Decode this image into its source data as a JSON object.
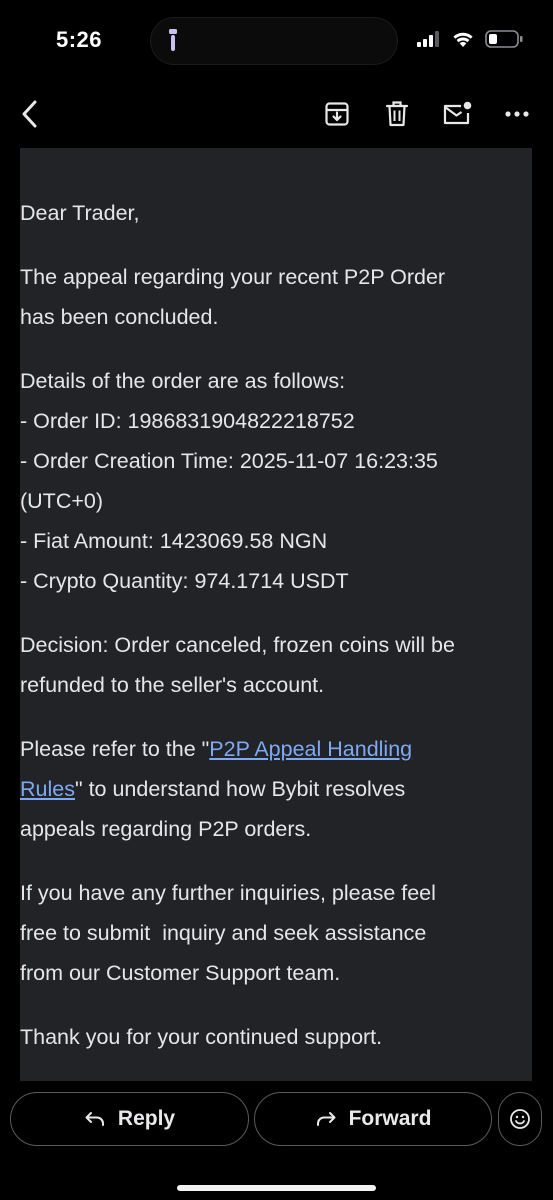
{
  "status_bar": {
    "time": "5:26"
  },
  "toolbar": {
    "back_icon": "chevron-left-icon",
    "archive_icon": "archive-icon",
    "delete_icon": "trash-icon",
    "mark_unread_icon": "mail-unread-icon",
    "more_icon": "more-horizontal-icon"
  },
  "email": {
    "greeting": "Dear Trader,",
    "p1_l1": "The appeal regarding your recent P2P Order",
    "p1_l2": "has been concluded.",
    "details_l1": "Details of the order are as follows:",
    "details_l2": "- Order ID: 1986831904822218752",
    "details_l3": "- Order Creation Time: 2025-11-07 16:23:35",
    "details_l4": "(UTC+0)",
    "details_l5": "- Fiat Amount: 1423069.58 NGN",
    "details_l6": "- Crypto Quantity: 974.1714 USDT",
    "decision_l1": "Decision: Order canceled, frozen coins will be",
    "decision_l2": "refunded to the seller's account.",
    "refer_pre": "Please refer to the \"",
    "refer_link_a": "P2P Appeal Handling",
    "refer_link_b": "Rules",
    "refer_post": "\" to understand how Bybit resolves",
    "refer_l3": "appeals regarding P2P orders.",
    "inquiry_l1": "If you have any further inquiries, please feel",
    "inquiry_l2": "free to submit  inquiry and seek assistance",
    "inquiry_l3": "from our Customer Support team.",
    "thanks": "Thank you for your continued support."
  },
  "actions": {
    "reply_label": "Reply",
    "forward_label": "Forward",
    "reply_icon": "reply-arrow-icon",
    "forward_icon": "forward-arrow-icon",
    "emoji_icon": "emoji-smile-icon"
  },
  "colors": {
    "link": "#7eaaf5",
    "email_background": "#222326",
    "app_background": "#000000"
  }
}
